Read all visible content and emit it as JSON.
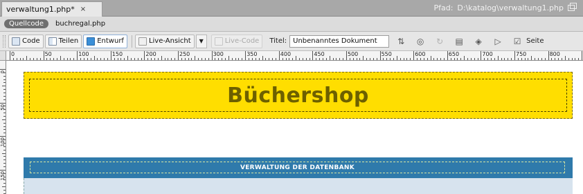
{
  "tab": {
    "filename": "verwaltung1.php*",
    "close": "×"
  },
  "path": {
    "label": "Pfad:",
    "value": "D:\\katalog\\verwaltung1.php"
  },
  "related": {
    "source": "Quellcode",
    "file": "buchregal.php"
  },
  "toolbar": {
    "code": "Code",
    "split": "Teilen",
    "design": "Entwurf",
    "live_view": "Live-Ansicht",
    "live_code": "Live-Code",
    "title_label": "Titel:",
    "title_value": "Unbenanntes Dokument",
    "page_label": "Seite"
  },
  "ruler": {
    "labels": [
      "0",
      "50",
      "100",
      "150",
      "200",
      "250",
      "300",
      "350",
      "400",
      "450",
      "500",
      "550",
      "600",
      "650",
      "700",
      "750",
      "800"
    ],
    "v_labels": [
      "0",
      "50",
      "100",
      "150"
    ]
  },
  "page": {
    "header_title": "Büchershop",
    "admin_title": "VERWALTUNG DER DATENBANK",
    "colors": {
      "header_bg": "#ffde00",
      "header_text": "#6d6000",
      "admin_bg": "#2f7aab",
      "content_bg": "#d7e3ee"
    }
  }
}
